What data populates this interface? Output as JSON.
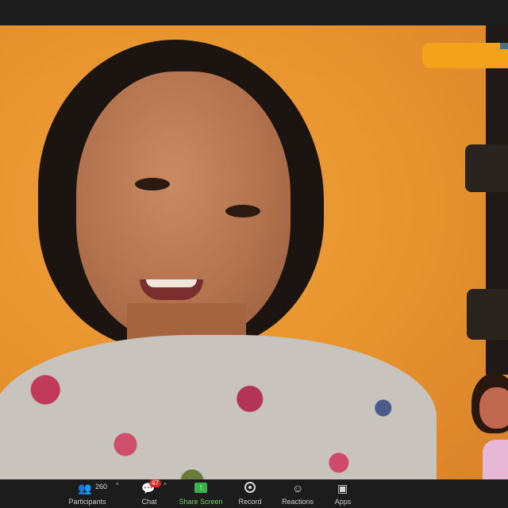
{
  "toolbar": {
    "participants": {
      "label": "Participants",
      "count": "260",
      "icon": "participants-icon"
    },
    "chat": {
      "label": "Chat",
      "badge": "47",
      "icon": "chat-icon"
    },
    "share": {
      "label": "Share Screen",
      "icon": "share-screen-icon"
    },
    "record": {
      "label": "Record",
      "icon": "record-icon"
    },
    "reactions": {
      "label": "Reactions",
      "icon": "reactions-icon"
    },
    "apps": {
      "label": "Apps",
      "icon": "apps-icon"
    }
  },
  "colors": {
    "background_orange": "#e8952e",
    "toolbar": "#1c1c1c",
    "share_green": "#3cb24a",
    "badge_red": "#e02828",
    "name_pill": "#f3a21c"
  }
}
